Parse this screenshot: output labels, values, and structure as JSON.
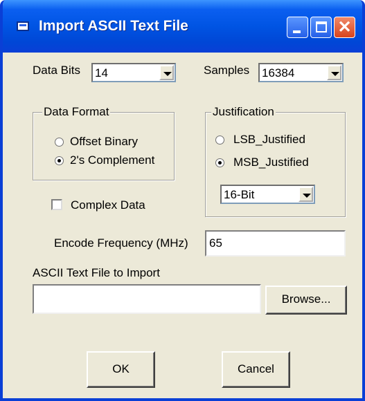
{
  "window": {
    "title": "Import ASCII Text File",
    "controls": {
      "minimize": "minimize-icon",
      "maximize": "maximize-icon",
      "close": "close-icon",
      "close_glyph": "✕"
    }
  },
  "data_bits": {
    "label": "Data Bits",
    "value": "14"
  },
  "samples": {
    "label": "Samples",
    "value": "16384"
  },
  "data_format": {
    "title": "Data Format",
    "options": [
      {
        "label": "Offset Binary",
        "checked": false
      },
      {
        "label": "2's Complement",
        "checked": true
      }
    ]
  },
  "justification": {
    "title": "Justification",
    "options": [
      {
        "label": "LSB_Justified",
        "checked": false
      },
      {
        "label": "MSB_Justified",
        "checked": true
      }
    ],
    "bit_width": "16-Bit"
  },
  "complex_data": {
    "label": "Complex Data",
    "checked": false
  },
  "encode_frequency": {
    "label": "Encode Frequency (MHz)",
    "value": "65"
  },
  "ascii_file": {
    "label": "ASCII Text File to Import",
    "value": "",
    "browse_label": "Browse..."
  },
  "buttons": {
    "ok": "OK",
    "cancel": "Cancel"
  }
}
